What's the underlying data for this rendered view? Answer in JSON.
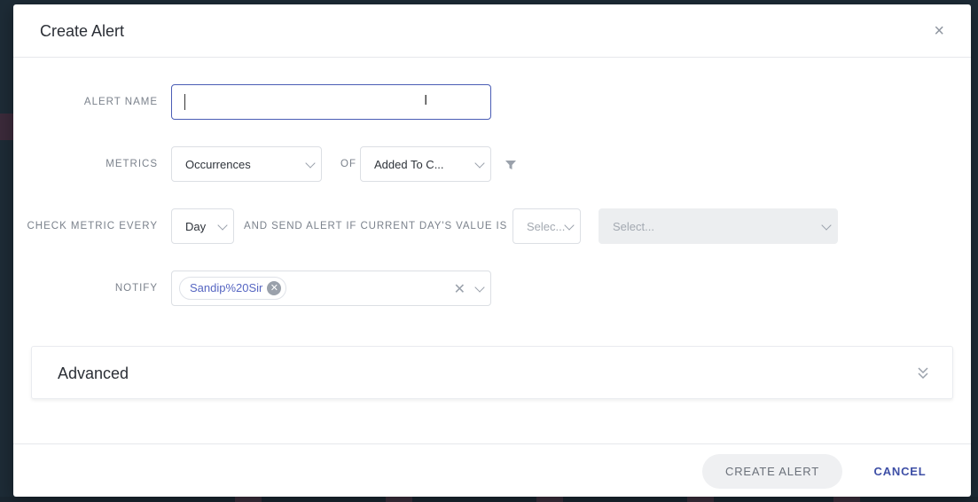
{
  "modal": {
    "title": "Create Alert",
    "close_icon": "close-icon"
  },
  "form": {
    "alert_name": {
      "label": "ALERT NAME",
      "value": ""
    },
    "metrics": {
      "label": "METRICS",
      "metric_value": "Occurrences",
      "of_label": "OF",
      "event_value": "Added To C..."
    },
    "check": {
      "label": "CHECK METRIC EVERY",
      "period_value": "Day",
      "condition_label": "AND SEND ALERT IF CURRENT DAY'S VALUE IS",
      "operator_placeholder": "Selec...",
      "threshold_placeholder": "Select..."
    },
    "notify": {
      "label": "NOTIFY",
      "chips": [
        "Sandip%20Sir"
      ]
    }
  },
  "advanced": {
    "title": "Advanced"
  },
  "footer": {
    "create_label": "CREATE ALERT",
    "cancel_label": "CANCEL"
  },
  "colors": {
    "accent": "#3e4fa6",
    "chip_text": "#5666c2",
    "overlay": "#1d2b36"
  }
}
